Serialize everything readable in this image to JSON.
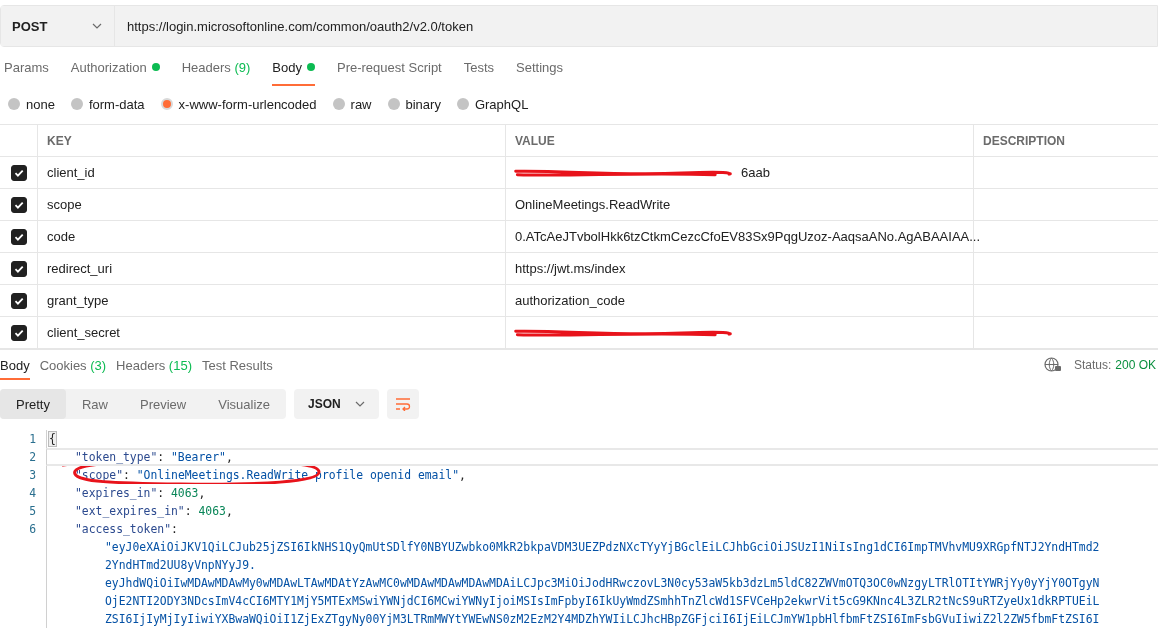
{
  "request": {
    "method": "POST",
    "url": "https://login.microsoftonline.com/common/oauth2/v2.0/token"
  },
  "request_tabs": [
    {
      "label": "Params",
      "selected": false,
      "dot": false
    },
    {
      "label": "Authorization",
      "selected": false,
      "dot": true
    },
    {
      "label": "Headers",
      "count": "(9)",
      "selected": false,
      "dot": false
    },
    {
      "label": "Body",
      "selected": true,
      "dot": true
    },
    {
      "label": "Pre-request Script",
      "selected": false,
      "dot": false
    },
    {
      "label": "Tests",
      "selected": false,
      "dot": false
    },
    {
      "label": "Settings",
      "selected": false,
      "dot": false
    }
  ],
  "body_types": [
    {
      "label": "none",
      "selected": false
    },
    {
      "label": "form-data",
      "selected": false
    },
    {
      "label": "x-www-form-urlencoded",
      "selected": true
    },
    {
      "label": "raw",
      "selected": false
    },
    {
      "label": "binary",
      "selected": false
    },
    {
      "label": "GraphQL",
      "selected": false
    }
  ],
  "params_table": {
    "columns": [
      "KEY",
      "VALUE",
      "DESCRIPTION"
    ],
    "rows": [
      {
        "checked": true,
        "key": "client_id",
        "value": "6aab",
        "redacted": true
      },
      {
        "checked": true,
        "key": "scope",
        "value": "OnlineMeetings.ReadWrite",
        "redacted": false
      },
      {
        "checked": true,
        "key": "code",
        "value": "0.ATcAeJTvbolHkk6tzCtkmCezcCfoEV83Sx9PqgUzoz-AaqsaANo.AgABAAIAA...",
        "redacted": false
      },
      {
        "checked": true,
        "key": "redirect_uri",
        "value": "https://jwt.ms/index",
        "redacted": false
      },
      {
        "checked": true,
        "key": "grant_type",
        "value": "authorization_code",
        "redacted": false
      },
      {
        "checked": true,
        "key": "client_secret",
        "redacted": true
      }
    ]
  },
  "response_tabs": [
    {
      "label": "Body",
      "selected": true
    },
    {
      "label": "Cookies",
      "count": "(3)",
      "selected": false
    },
    {
      "label": "Headers",
      "count": "(15)",
      "selected": false
    },
    {
      "label": "Test Results",
      "selected": false
    }
  ],
  "status": {
    "label": "Status:",
    "value": "200 OK"
  },
  "view_modes": [
    {
      "label": "Pretty",
      "selected": true
    },
    {
      "label": "Raw",
      "selected": false
    },
    {
      "label": "Preview",
      "selected": false
    },
    {
      "label": "Visualize",
      "selected": false
    }
  ],
  "format": "JSON",
  "code_lines": [
    {
      "kind": "line",
      "number": "1",
      "current": false,
      "parts": [
        {
          "kind": "brace",
          "text": "{"
        }
      ]
    },
    {
      "kind": "line",
      "number": "2",
      "current": true,
      "parts": [
        {
          "kind": "key",
          "text": "\"token_type\""
        },
        {
          "kind": "punct",
          "text": ": "
        },
        {
          "kind": "string",
          "text": "\"Bearer\""
        },
        {
          "kind": "punct",
          "text": ","
        }
      ]
    },
    {
      "kind": "line",
      "number": "3",
      "current": false,
      "circled": true,
      "parts": [
        {
          "kind": "key",
          "text": "\"scope\""
        },
        {
          "kind": "punct",
          "text": ": "
        },
        {
          "kind": "string",
          "text": "\"OnlineMeetings.ReadWrite profile openid email\""
        },
        {
          "kind": "punct",
          "text": ","
        }
      ]
    },
    {
      "kind": "line",
      "number": "4",
      "current": false,
      "parts": [
        {
          "kind": "key",
          "text": "\"expires_in\""
        },
        {
          "kind": "punct",
          "text": ": "
        },
        {
          "kind": "number",
          "text": "4063"
        },
        {
          "kind": "punct",
          "text": ","
        }
      ]
    },
    {
      "kind": "line",
      "number": "5",
      "current": false,
      "parts": [
        {
          "kind": "key",
          "text": "\"ext_expires_in\""
        },
        {
          "kind": "punct",
          "text": ": "
        },
        {
          "kind": "number",
          "text": "4063"
        },
        {
          "kind": "punct",
          "text": ","
        }
      ]
    },
    {
      "kind": "line",
      "number": "6",
      "current": false,
      "parts": [
        {
          "kind": "key",
          "text": "\"access_token\""
        },
        {
          "kind": "punct",
          "text": ":"
        }
      ]
    },
    {
      "kind": "wrap",
      "current": false,
      "parts": [
        {
          "kind": "string",
          "text": "\"eyJ0eXAiOiJKV1QiLCJub25jZSI6IkNHS1QyQmUtSDlfY0NBYUZwbko0MkR2bkpaVDM3UEZPdzNXcTYyYjBGclEiLCJhbGciOiJSUzI1NiIsIng1dCI6ImpTMVhvMU9XRGpfNTJ2YndHTmd2"
        }
      ]
    },
    {
      "kind": "wrap",
      "current": false,
      "parts": [
        {
          "kind": "string",
          "text": "2YndHTmd2UU8yVnpNYyJ9."
        }
      ]
    },
    {
      "kind": "wrap",
      "current": false,
      "parts": [
        {
          "kind": "string",
          "text": "eyJhdWQiOiIwMDAwMDAwMy0wMDAwLTAwMDAtYzAwMC0wMDAwMDAwMDAwMDAiLCJpc3MiOiJodHRwczovL3N0cy53aW5kb3dzLm5ldC82ZWVmOTQ3OC0wNzgyLTRlOTItYWRjYy0yYjY0OTgyN"
        }
      ]
    },
    {
      "kind": "wrap",
      "current": false,
      "parts": [
        {
          "kind": "string",
          "text": "OjE2NTI2ODY3NDcsImV4cCI6MTY1MjY5MTExMSwiYWNjdCI6MCwiYWNyIjoiMSIsImFpbyI6IkUyWmdZSmhhTnZlcWd1SFVCeHp2ekwrVit5cG9KNnc4L3ZLR2tNcS9uRTZyeUx1dkRPTUEiL"
        }
      ]
    },
    {
      "kind": "wrap",
      "current": false,
      "parts": [
        {
          "kind": "string",
          "text": "ZSI6IjIyMjIyIiwiYXBwaWQiOiI1ZjExZTgyNy00YjM3LTRmMWYtYWEwNS0zM2EzM2Y4MDZhYWIiLCJhcHBpZGFjciI6IjEiLCJmYW1pbHlfbmFtZSI6ImFsbGVuIiwiZ2l2ZW5fbmFtZSI6I"
        }
      ]
    }
  ]
}
